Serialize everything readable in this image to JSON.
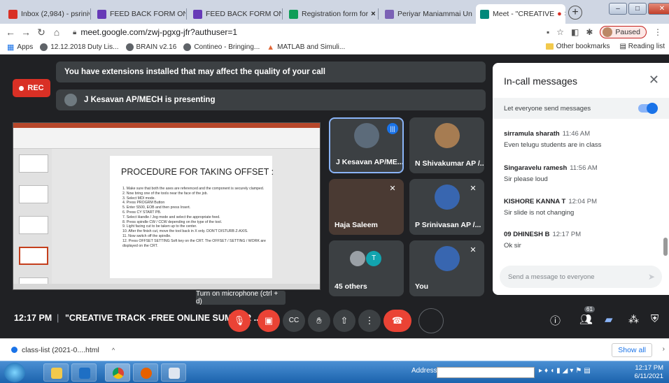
{
  "browser": {
    "tabs": [
      {
        "label": "Inbox (2,984) - psriniva",
        "active": false
      },
      {
        "label": "FEED BACK FORM ON",
        "active": false
      },
      {
        "label": "FEED BACK FORM ON",
        "active": false
      },
      {
        "label": "Registration form for",
        "active": false
      },
      {
        "label": "Periyar Maniammai Un",
        "active": false
      },
      {
        "label": "Meet - \"CREATIVE",
        "active": true
      }
    ],
    "url": "meet.google.com/zwj-pgxg-jfr?authuser=1",
    "profile_status": "Paused",
    "bookmarks": [
      "Apps",
      "12.12.2018 Duty Lis...",
      "BRAIN v2.16",
      "Contineo - Bringing...",
      "MATLAB and Simuli..."
    ],
    "other_bookmarks": "Other bookmarks",
    "reading_list": "Reading list"
  },
  "meet": {
    "rec_label": "REC",
    "extension_warning": "You have extensions installed that may affect the quality of your call",
    "presenting": "J Kesavan AP/MECH is presenting",
    "slide": {
      "heading": "PROCEDURE FOR TAKING  OFFSET :",
      "steps": [
        "1. Make sure that both the axes are referenced and the component is securely clamped.",
        "2. Now bring one of the tools near the face of the job.",
        "3. Select MDI mode.",
        "4. Press PROGRM Button",
        "5. Enter S500, EOB and then press Insert.",
        "6. Press CY START PB.",
        "7. Select Handle / Jog mode and select the appropriate feed.",
        "8. Press spindle CW / CCW depending on the type of the tool.",
        "9. Light facing cut to be taken up to the center.",
        "10. After the finish cut, move the tool back in X only. DON'T DISTURB Z-AXIS.",
        "11. Now switch off the spindle.",
        "12. Press OFFSET SETTING Soft key on the CRT. The OFFSET / SETTING / WORK are displayed on the CRT."
      ]
    },
    "participants": [
      {
        "name": "J Kesavan AP/ME..."
      },
      {
        "name": "N Shivakumar AP /..."
      },
      {
        "name": "Haja Saleem"
      },
      {
        "name": "P Srinivasan AP /..."
      },
      {
        "name": "45 others"
      },
      {
        "name": "You"
      }
    ],
    "others_initial": "T",
    "chat": {
      "title": "In-call messages",
      "toggle_label": "Let everyone send messages",
      "messages": [
        {
          "sender": "sirramula sharath",
          "time": "11:46 AM",
          "text": "Even telugu students are in class"
        },
        {
          "sender": "Singaravelu ramesh",
          "time": "11:56 AM",
          "text": "Sir please loud"
        },
        {
          "sender": "KISHORE KANNA T",
          "time": "12:04 PM",
          "text": "Sir slide is not changing"
        },
        {
          "sender": "09 DHINESH B",
          "time": "12:17 PM",
          "text": "Ok sir"
        }
      ],
      "input_placeholder": "Send a message to everyone"
    },
    "tooltip": "Turn on microphone (ctrl + d)",
    "time": "12:17 PM",
    "meeting_name": "\"CREATIVE TRACK -FREE ONLINE SUMMER ...",
    "participant_count": "61"
  },
  "downloads": {
    "file": "class-list (2021-0....html",
    "show_all": "Show all"
  },
  "taskbar": {
    "address_label": "Address",
    "clock_time": "12:17 PM",
    "clock_date": "6/11/2021"
  }
}
